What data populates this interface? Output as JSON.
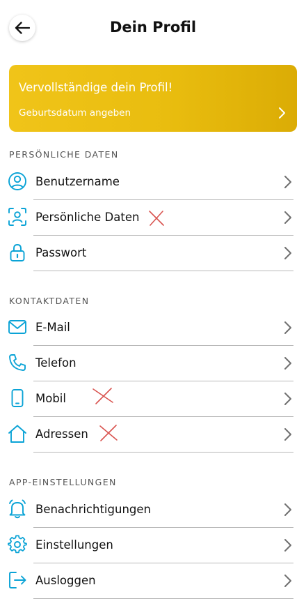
{
  "header": {
    "title": "Dein Profil"
  },
  "banner": {
    "title": "Vervollständige dein Profil!",
    "subtitle": "Geburtsdatum angeben"
  },
  "sections": [
    {
      "heading": "PERSÖNLICHE DATEN",
      "items": [
        {
          "label": "Benutzername",
          "icon": "user-circle-icon"
        },
        {
          "label": "Persönliche Daten",
          "icon": "face-scan-icon"
        },
        {
          "label": "Passwort",
          "icon": "lock-icon"
        }
      ]
    },
    {
      "heading": "KONTAKTDATEN",
      "items": [
        {
          "label": "E-Mail",
          "icon": "envelope-icon"
        },
        {
          "label": "Telefon",
          "icon": "phone-icon"
        },
        {
          "label": "Mobil",
          "icon": "mobile-phone-icon"
        },
        {
          "label": "Adressen",
          "icon": "house-icon"
        }
      ]
    },
    {
      "heading": "APP-EINSTELLUNGEN",
      "items": [
        {
          "label": "Benachrichtigungen",
          "icon": "bell-icon"
        },
        {
          "label": "Einstellungen",
          "icon": "gear-icon"
        },
        {
          "label": "Ausloggen",
          "icon": "logout-icon"
        }
      ]
    }
  ],
  "colors": {
    "accent": "#0aa3d6",
    "banner": "#e9bd0f",
    "mark": "#d9534f"
  }
}
